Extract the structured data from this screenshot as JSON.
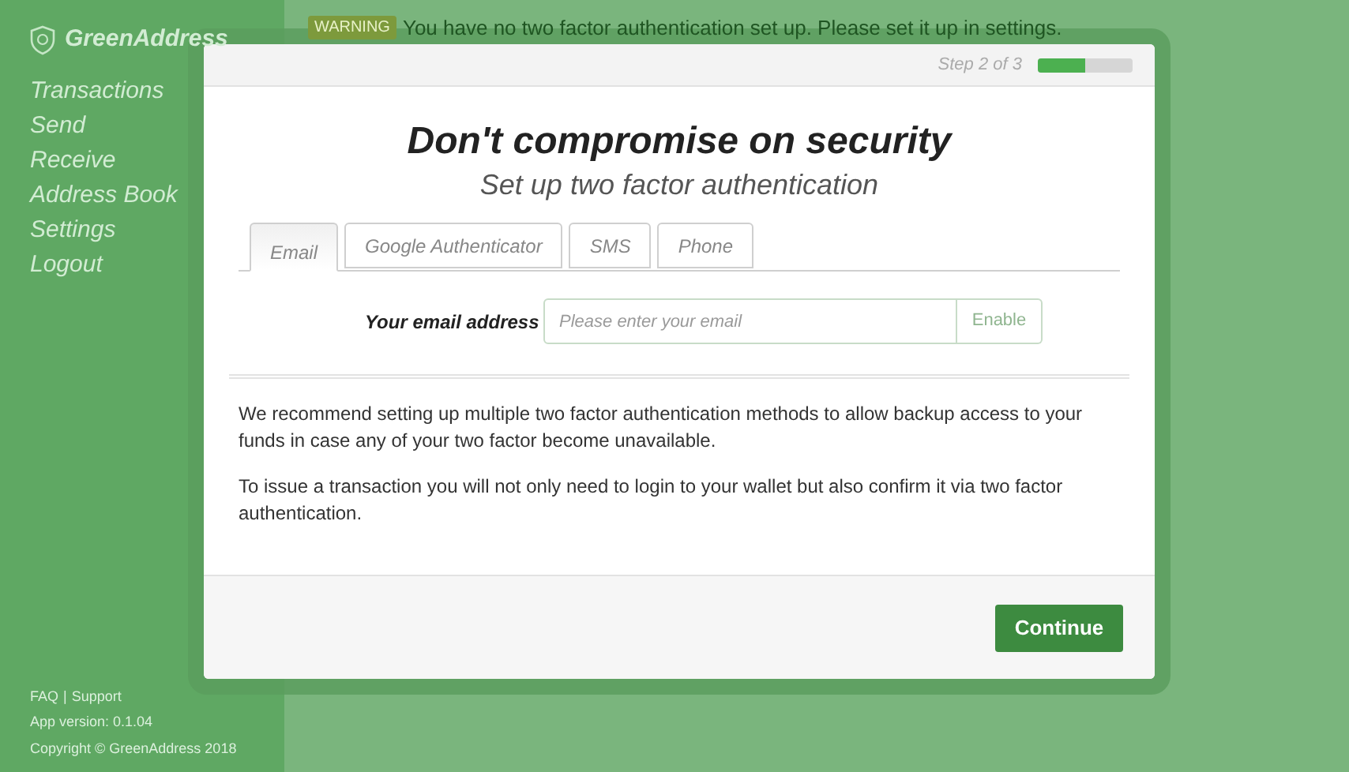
{
  "sidebar": {
    "logo": "GreenAddress",
    "items": [
      {
        "label": "Transactions"
      },
      {
        "label": "Send"
      },
      {
        "label": "Receive"
      },
      {
        "label": "Address Book"
      },
      {
        "label": "Settings"
      },
      {
        "label": "Logout"
      }
    ],
    "footer": {
      "links": [
        "FAQ",
        "|",
        "Support"
      ],
      "version": "App version: 0.1.04",
      "copyright": "Copyright © GreenAddress 2018"
    }
  },
  "warning": {
    "badge": "WARNING",
    "message": "You have no two factor authentication set up. Please set it up in settings."
  },
  "modal": {
    "step": "Step 2 of 3",
    "progress": {
      "level": 0.5
    },
    "title": "Don't compromise on security",
    "subtitle": "Set up two factor authentication",
    "tabs": [
      {
        "label": "Email",
        "selected": true
      },
      {
        "label": "Google Authenticator",
        "selected": false
      },
      {
        "label": "SMS",
        "selected": false
      },
      {
        "label": "Phone",
        "selected": false
      }
    ],
    "email_form": {
      "label": "Your email address",
      "placeholder": "Please enter your email",
      "button": "Enable"
    },
    "paragraphs": [
      "We recommend setting up multiple two factor authentication methods to allow backup access to your funds in case any of your two factor become unavailable.",
      "To issue a transaction you will not only need to login to your wallet but also confirm it via two factor authentication."
    ],
    "continue_button": "Continue"
  }
}
